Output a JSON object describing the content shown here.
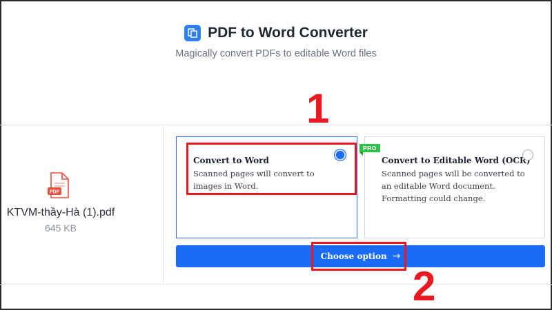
{
  "header": {
    "title": "PDF to Word Converter",
    "subtitle": "Magically convert PDFs to editable Word files",
    "icon": "pdf-to-word-icon"
  },
  "file": {
    "icon": "pdf-file-icon",
    "icon_label": "PDF",
    "name": "KTVM-thầy-Hà (1).pdf",
    "size": "645 KB"
  },
  "options": [
    {
      "title": "Convert to Word",
      "description": "Scanned pages will convert to images in Word.",
      "selected": true
    },
    {
      "title": "Convert to Editable Word (OCR)",
      "description": "Scanned pages will be converted to an editable Word document. Formatting could change.",
      "badge": "PRO",
      "selected": false
    }
  ],
  "action": {
    "label": "Choose option",
    "arrow": "→"
  },
  "annotations": {
    "step1": "1",
    "step2": "2",
    "color": "#e8191f"
  },
  "colors": {
    "primary": "#1a6cf5",
    "pro_badge": "#2fbf4a"
  }
}
